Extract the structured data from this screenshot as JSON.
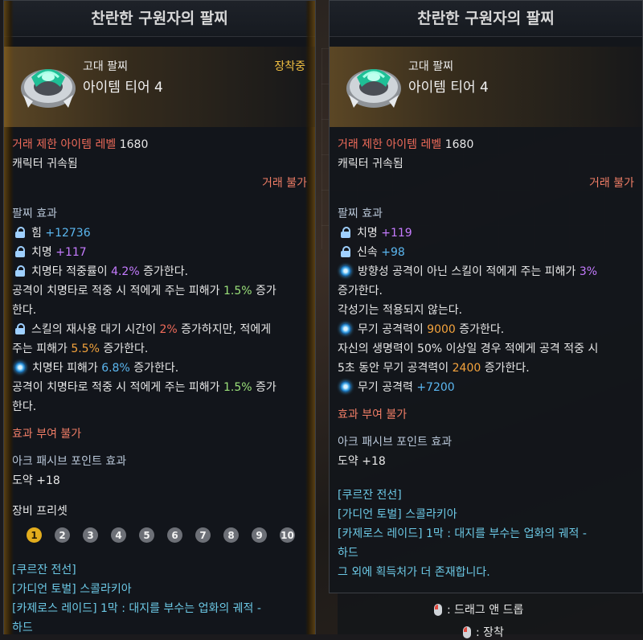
{
  "left": {
    "title": "찬란한 구원자의 팔찌",
    "grade": "고대 팔찌",
    "tier": "아이템 티어 4",
    "equipped": "장착중",
    "req_label": "거래 제한 아이템 레벨",
    "req_value": "1680",
    "bound": "캐릭터 귀속됨",
    "trade": "거래 불가",
    "effect_header": "팔찌 효과",
    "e1_label": "힘",
    "e1_value": "+12736",
    "e2_label": "치명",
    "e2_value": "+117",
    "e3_a": "치명타 적중률이",
    "e3_b": "4.2%",
    "e3_c": "증가한다.",
    "e3_d": "공격이 치명타로 적중 시 적에게 주는 피해가",
    "e3_e": "1.5%",
    "e3_f": "증가",
    "e3_g": "한다.",
    "e4_a": "스킬의 재사용 대기 시간이",
    "e4_b": "2%",
    "e4_c": "증가하지만, 적에게",
    "e4_d": "주는 피해가",
    "e4_e": "5.5%",
    "e4_f": "증가한다.",
    "e5_a": "치명타 피해가",
    "e5_b": "6.8%",
    "e5_c": "증가한다.",
    "e5_d": "공격이 치명타로 적중 시 적에게 주는 피해가",
    "e5_e": "1.5%",
    "e5_f": "증가",
    "e5_g": "한다.",
    "no_effect": "효과 부여 불가",
    "ark_header": "아크 패시브 포인트 효과",
    "ark_value": "도약 +18",
    "preset_header": "장비 프리셋",
    "presets": [
      "1",
      "2",
      "3",
      "4",
      "5",
      "6",
      "7",
      "8",
      "9",
      "10"
    ],
    "src1": "[쿠르잔 전선]",
    "src2": "[가디언 토벌] 스콜라키아",
    "src3": "[카제로스 레이드] 1막 : 대지를 부수는 업화의 궤적 -",
    "src4": "하드"
  },
  "right": {
    "title": "찬란한 구원자의 팔찌",
    "grade": "고대 팔찌",
    "tier": "아이템 티어 4",
    "req_label": "거래 제한 아이템 레벨",
    "req_value": "1680",
    "bound": "캐릭터 귀속됨",
    "trade": "거래 불가",
    "effect_header": "팔찌 효과",
    "e1_label": "치명",
    "e1_value": "+119",
    "e2_label": "신속",
    "e2_value": "+98",
    "e3_a": "방향성 공격이 아닌 스킬이 적에게 주는 피해가",
    "e3_b": "3%",
    "e3_c": "증가한다.",
    "e3_d": "각성기는 적용되지 않는다.",
    "e4_a": "무기 공격력이",
    "e4_b": "9000",
    "e4_c": "증가한다.",
    "e4_d": "자신의 생명력이 50% 이상일 경우 적에게 공격 적중 시",
    "e4_e": "5초 동안 무기 공격력이",
    "e4_f": "2400",
    "e4_g": "증가한다.",
    "e5_label": "무기 공격력",
    "e5_value": "+7200",
    "no_effect": "효과 부여 불가",
    "ark_header": "아크 패시브 포인트 효과",
    "ark_value": "도약 +18",
    "src1": "[쿠르잔 전선]",
    "src2": "[가디언 토벌] 스콜라키아",
    "src3": "[카제로스 레이드] 1막 : 대지를 부수는 업화의 궤적 -",
    "src4": "하드",
    "src5": "그 외에 획득처가 더 존재합니다."
  },
  "hints": {
    "drag": ": 드래그 앤 드롭",
    "equip": ": 장착"
  },
  "icons": {
    "locked_effect": "lock-icon",
    "special_effect": "swirl-icon",
    "mouse": "mouse-icon"
  }
}
